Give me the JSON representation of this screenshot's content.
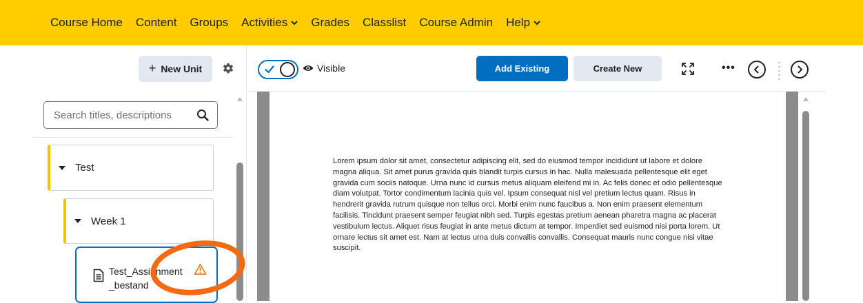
{
  "topnav": {
    "items": [
      {
        "label": "Course Home"
      },
      {
        "label": "Content"
      },
      {
        "label": "Groups"
      },
      {
        "label": "Activities"
      },
      {
        "label": "Grades"
      },
      {
        "label": "Classlist"
      },
      {
        "label": "Course Admin"
      },
      {
        "label": "Help"
      }
    ]
  },
  "sidebar": {
    "new_unit_plus": "+",
    "new_unit_label": "New Unit",
    "search_placeholder": "Search titles, descriptions",
    "units": [
      {
        "label": "Test"
      },
      {
        "label": "Week 1"
      }
    ],
    "topic": {
      "title": "Test_Assignment_bestand"
    }
  },
  "toolbar": {
    "visible_label": "Visible",
    "add_existing": "Add Existing",
    "create_new": "Create New",
    "more": "•••"
  },
  "document": {
    "body": "Lorem ipsum dolor sit amet, consectetur adipiscing elit, sed do eiusmod tempor incididunt ut labore et dolore magna aliqua. Sit amet purus gravida quis blandit turpis cursus in hac. Nulla malesuada pellentesque elit eget gravida cum sociis natoque. Urna nunc id cursus metus aliquam eleifend mi in. Ac felis donec et odio pellentesque diam volutpat. Tortor condimentum lacinia quis vel. Ipsum consequat nisl vel pretium lectus quam. Risus in hendrerit gravida rutrum quisque non tellus orci. Morbi enim nunc faucibus a. Non enim praesent elementum facilisis. Tincidunt praesent semper feugiat nibh sed. Turpis egestas pretium aenean pharetra magna ac placerat vestibulum lectus. Aliquet risus feugiat in ante metus dictum at tempor. Imperdiet sed euismod nisi porta lorem. Ut ornare lectus sit amet est. Nam at lectus urna duis convallis convallis. Consequat mauris nunc congue nisi vitae suscipit."
  },
  "colors": {
    "nav_bar": "#ffcc00",
    "primary": "#006fbf",
    "unit_accent": "#f2c200",
    "annotation": "#f36a12",
    "warning": "#e87511"
  },
  "icons": {
    "activities_menu": "chevron-down-icon",
    "help_menu": "chevron-down-icon",
    "settings": "gear-icon",
    "search": "search-icon",
    "unit_toggle": "caret-down-icon",
    "topic_type": "document-icon",
    "topic_alert": "warning-icon",
    "visibility": "eye-icon",
    "fullscreen": "expand-icon",
    "previous": "chevron-left-icon",
    "next": "chevron-right-icon"
  }
}
